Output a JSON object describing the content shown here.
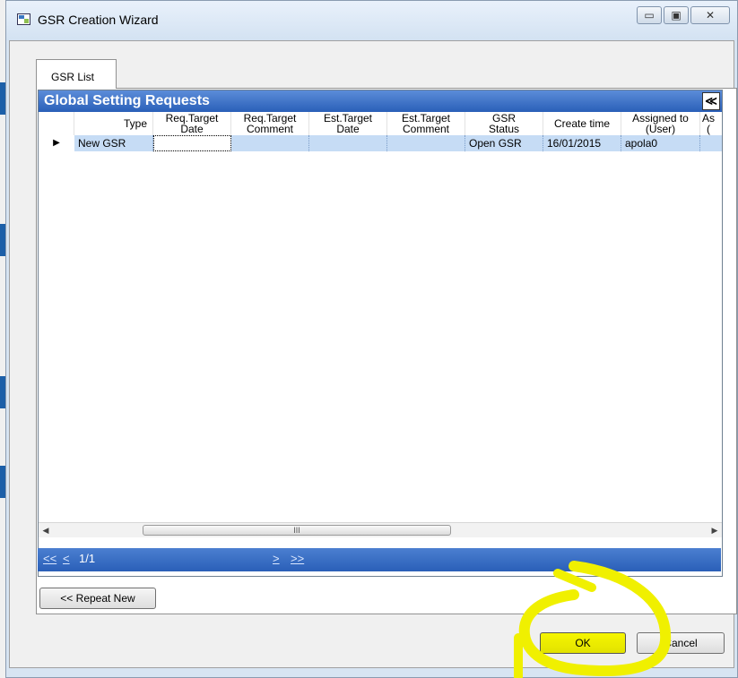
{
  "window": {
    "title": "GSR Creation Wizard"
  },
  "caption_buttons": {
    "minimize": "▭",
    "maximize": "▣",
    "close": "✕"
  },
  "tabs": [
    {
      "label": "GSR List"
    }
  ],
  "grid": {
    "title": "Global Setting Requests",
    "collapse_glyph": "≪",
    "columns": [
      {
        "label": "Type"
      },
      {
        "label": "Req.Target\nDate"
      },
      {
        "label": "Req.Target\nComment"
      },
      {
        "label": "Est.Target\nDate"
      },
      {
        "label": "Est.Target\nComment"
      },
      {
        "label": "GSR\nStatus"
      },
      {
        "label": "Create time"
      },
      {
        "label": "Assigned to\n(User)"
      },
      {
        "label": "As\n("
      }
    ],
    "rows": [
      {
        "indicator": "▶",
        "cells": [
          "New GSR",
          "",
          "",
          "",
          "",
          "Open GSR",
          "16/01/2015",
          "apola0",
          ""
        ]
      }
    ],
    "scroll_left": "◀",
    "scroll_right": "▶",
    "scroll_grip": "III"
  },
  "pager": {
    "first": "<<",
    "prev": "<",
    "page": "1/1",
    "next": ">",
    "last": ">>"
  },
  "buttons": {
    "repeat_new": "<< Repeat New",
    "ok": "OK",
    "cancel": "Cancel"
  },
  "colors": {
    "header_blue": "#2a5fb8",
    "row_selected": "#c6dcf5",
    "annotation_yellow": "#f0f000"
  }
}
